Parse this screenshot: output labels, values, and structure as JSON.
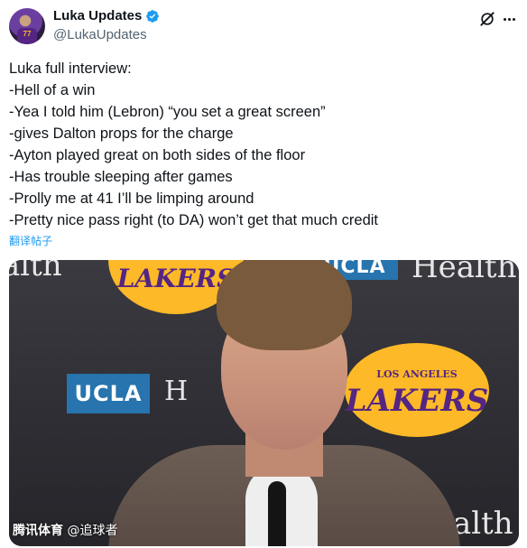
{
  "author": {
    "display_name": "Luka Updates",
    "handle": "@LukaUpdates",
    "avatar_number": "77",
    "verified_icon": "verified-badge-icon"
  },
  "header_icons": {
    "grok": "grok-icon",
    "more": "more-icon"
  },
  "tweet": {
    "lines": [
      "Luka full interview:",
      "-Hell of a win",
      "-Yea I told him (Lebron) “you set a great screen”",
      "-gives Dalton props for the charge",
      "-Ayton played great on both sides of the floor",
      "-Has trouble sleeping after games",
      "-Prolly me at 41 I’ll be limping around",
      "-Pretty nice pass right (to DA) won’t get that much credit"
    ],
    "translate_label": "翻译帖子"
  },
  "media": {
    "backdrop_logos": {
      "lakers_top": "LAKERS",
      "lakers_right_top": "LOS ANGELES",
      "lakers_right": "LAKERS",
      "ucla": "UCLA",
      "health": "Health",
      "health_partial_left": "alth",
      "health_partial_mid": "H",
      "health_partial_bottom": "alth"
    },
    "watermark_brand": "腾讯体育",
    "watermark_user": "@追球者"
  },
  "colors": {
    "lakers_purple": "#552583",
    "lakers_gold": "#fdb927",
    "ucla_blue": "#2774ae",
    "link_blue": "#1d9bf0",
    "verified_blue": "#1d9bf0"
  }
}
